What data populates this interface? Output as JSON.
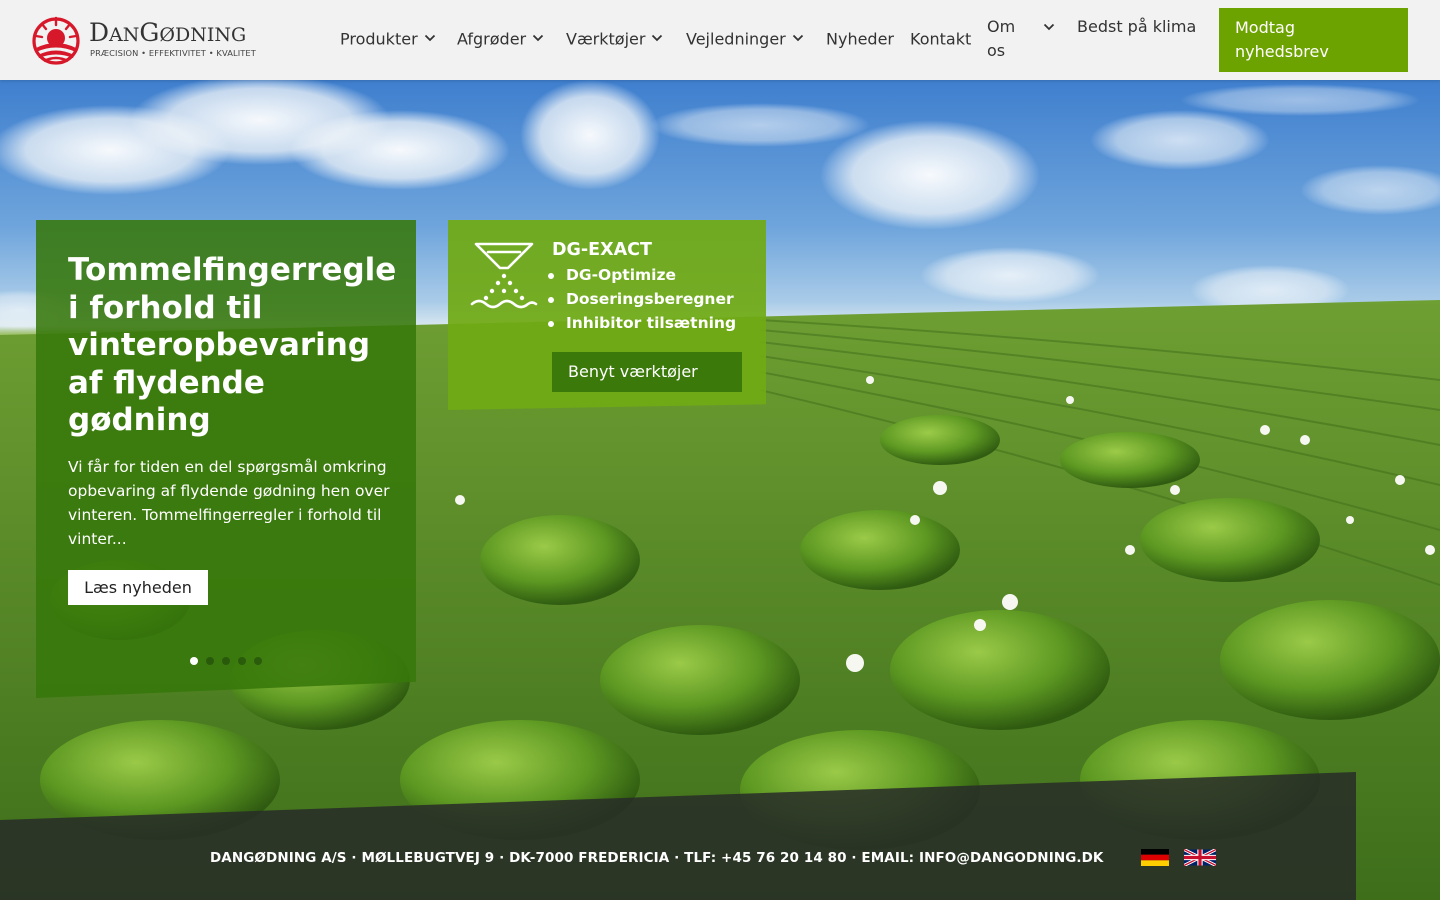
{
  "brand": {
    "name": "DanGødning",
    "tagline": "PRÆCISION • EFFEKTIVITET • KVALITET",
    "colors": {
      "primary_green": "#6da300",
      "logo_red": "#d7182a",
      "dark_green": "#3b7a0a"
    }
  },
  "nav": {
    "items": [
      {
        "label": "Produkter",
        "icon": "chevron-down-icon"
      },
      {
        "label": "Afgrøder",
        "icon": "chevron-down-icon"
      },
      {
        "label": "Værktøjer",
        "icon": "chevron-down-icon"
      },
      {
        "label": "Vejledninger",
        "icon": "chevron-down-icon"
      },
      {
        "label": "Nyheder"
      },
      {
        "label": "Kontakt"
      },
      {
        "label": "Om os",
        "icon": "chevron-down-icon"
      },
      {
        "label": "Bedst på klima"
      }
    ],
    "newsletter_button": "Modtag nyhedsbrev"
  },
  "news": {
    "title": "Tommelfingerregle i forhold til vinteropbevaring af flydende gødning",
    "excerpt": "Vi får for tiden en del spørgsmål omkring opbevaring af flydende gødning hen over vinteren. Tommelfingerregler i forhold til vinter...",
    "read_button": "Læs nyheden",
    "slides": {
      "count": 5,
      "active": 1
    }
  },
  "tools": {
    "icon": "fertilizer-spreader-icon",
    "title": "DG-EXACT",
    "items": [
      "DG-Optimize",
      "Doseringsberegner",
      "Inhibitor tilsætning"
    ],
    "button": "Benyt værktøjer"
  },
  "footer": {
    "contact": "DANGØDNING A/S · MØLLEBUGTVEJ 9 · DK-7000 FREDERICIA · TLF: +45 76 20 14 80 · EMAIL: INFO@DANGODNING.DK",
    "languages": [
      {
        "code": "de",
        "icon": "german-flag-icon"
      },
      {
        "code": "en",
        "icon": "uk-flag-icon"
      }
    ]
  }
}
